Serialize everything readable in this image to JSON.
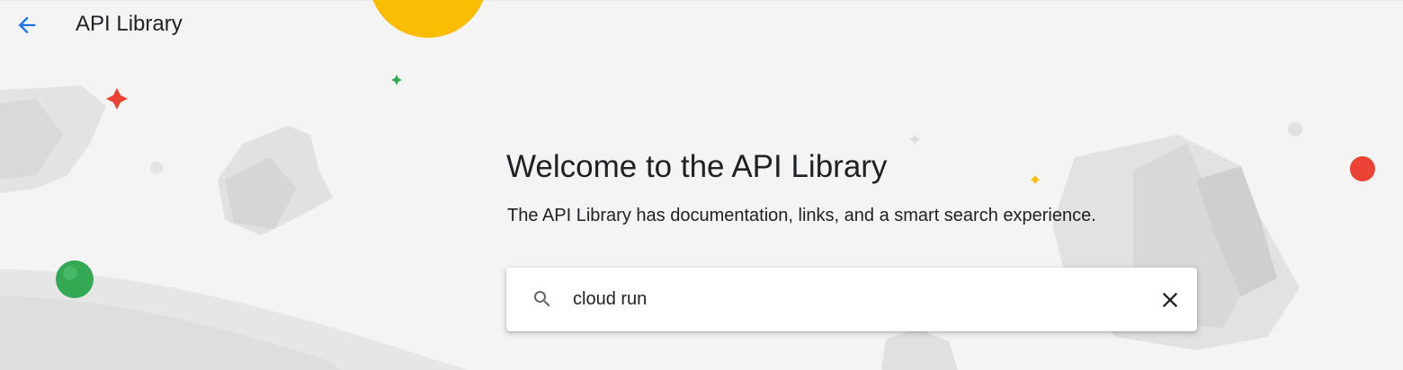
{
  "header": {
    "title": "API Library",
    "back_icon": "arrow-back-icon"
  },
  "welcome": {
    "title": "Welcome to the API Library",
    "subtitle": "The API Library has documentation, links, and a smart search experience."
  },
  "search": {
    "value": "cloud run",
    "search_icon": "search-icon",
    "clear_icon": "close-icon"
  },
  "colors": {
    "accent": "#1a73e8",
    "google_yellow": "#fbbc04",
    "google_red": "#ea4335",
    "google_green": "#34a853",
    "background": "#f4f4f4"
  }
}
